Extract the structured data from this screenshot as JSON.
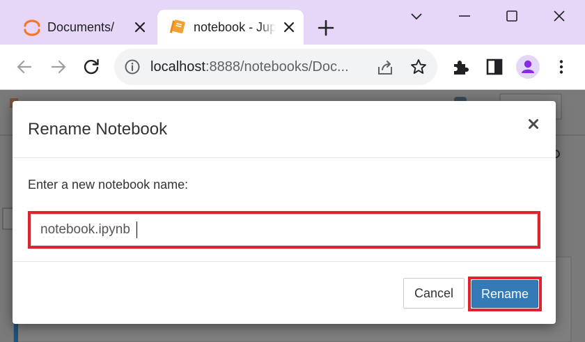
{
  "browser": {
    "tabs": [
      {
        "title": "Documents/",
        "favicon": "jupyter-icon",
        "active": false
      },
      {
        "title": "notebook - Jupyter Notebook",
        "favicon": "notebook-icon",
        "active": true
      }
    ],
    "url_host": "localhost",
    "url_path": ":8888/notebooks/Doc..."
  },
  "dialog": {
    "title": "Rename Notebook",
    "prompt": "Enter a new notebook name:",
    "input_value": "notebook.ipynb",
    "cancel_label": "Cancel",
    "rename_label": "Rename"
  },
  "colors": {
    "tabbar_bg": "#e6d7f8",
    "highlight": "#e0212e",
    "primary_button": "#337ab7",
    "profile_accent": "#8a2be2"
  }
}
